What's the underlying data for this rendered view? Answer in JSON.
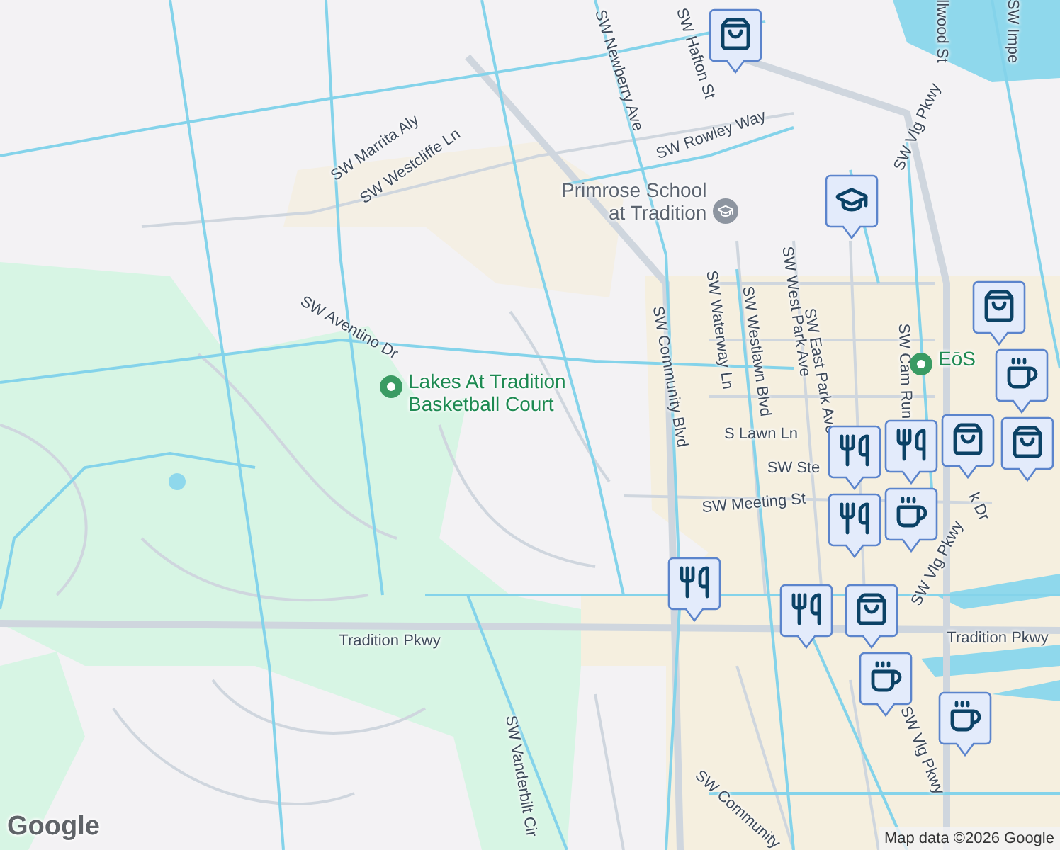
{
  "map": {
    "street_labels": [
      "SW Newberry Ave",
      "SW Hafton St",
      "SW Rowley Way",
      "SW Marrita Aly",
      "SW Westcliffe Ln",
      "SW Vlg Pkwy",
      "SW Community Blvd",
      "SW Waterway Ln",
      "SW Westlawn Blvd",
      "SW West Park Ave",
      "SW East Park Ave",
      "SW Cam Run",
      "SW Aventino Dr",
      "S Lawn Ln",
      "SW Ste",
      "SW Meeting St",
      "k Dr",
      "SW Vlg Pkwy",
      "Tradition Pkwy",
      "Tradition Pkwy",
      "SW Vlg Pkwy",
      "SW Community",
      "SW Vanderbilt Cir",
      "SW Impe",
      "llwood St"
    ],
    "places": [
      {
        "lines": [
          "Primrose School",
          "at Tradition"
        ],
        "kind": "school"
      },
      {
        "lines": [
          "Lakes At Tradition",
          "Basketball Court"
        ],
        "kind": "park"
      },
      {
        "lines": [
          "EōS"
        ],
        "kind": "park"
      }
    ]
  },
  "attribution": {
    "logo": "Google",
    "text": "Map data ©2026 Google"
  }
}
